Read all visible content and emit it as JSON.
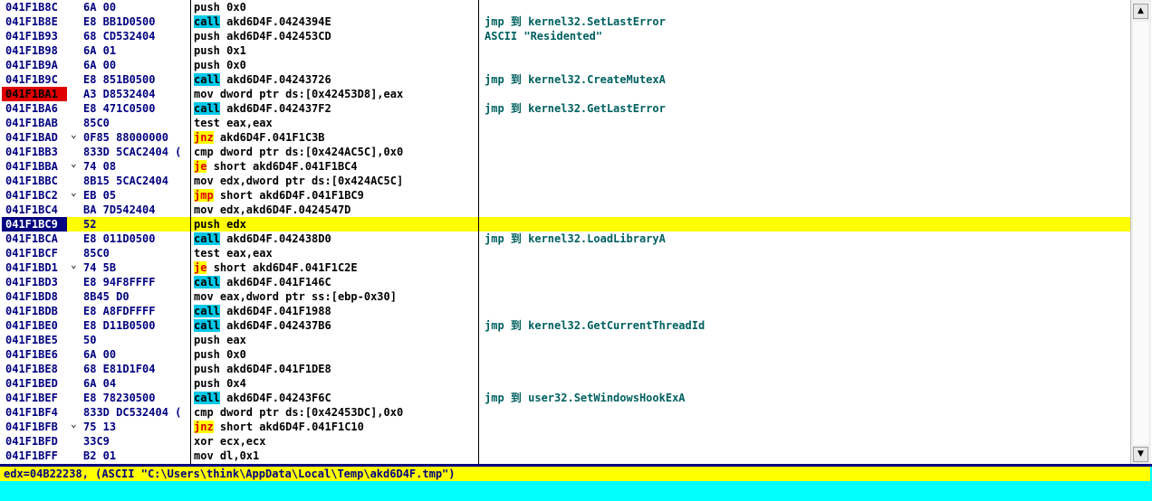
{
  "disasm": {
    "rows": [
      {
        "addr": "041F1B8C",
        "hex": "6A 00",
        "asm": "push 0x0",
        "cmt": ""
      },
      {
        "addr": "041F1B8E",
        "hex": "E8 BB1D0500",
        "kw": "call",
        "kwType": "call",
        "asm": "akd6D4F.0424394E",
        "cmt": "jmp 到 kernel32.SetLastError"
      },
      {
        "addr": "041F1B93",
        "hex": "68 CD532404",
        "asm": "push akd6D4F.042453CD",
        "cmt": "ASCII \"Residented\""
      },
      {
        "addr": "041F1B98",
        "hex": "6A 01",
        "asm": "push 0x1",
        "cmt": ""
      },
      {
        "addr": "041F1B9A",
        "hex": "6A 00",
        "asm": "push 0x0",
        "cmt": ""
      },
      {
        "addr": "041F1B9C",
        "hex": "E8 851B0500",
        "kw": "call",
        "kwType": "call",
        "asm": "akd6D4F.04243726",
        "cmt": "jmp 到 kernel32.CreateMutexA"
      },
      {
        "addr": "041F1BA1",
        "hex": "A3 D8532404",
        "asm": "mov dword ptr ds:[0x42453D8],eax",
        "cmt": "",
        "bp": true
      },
      {
        "addr": "041F1BA6",
        "hex": "E8 471C0500",
        "kw": "call",
        "kwType": "call",
        "asm": "akd6D4F.042437F2",
        "cmt": "jmp 到 kernel32.GetLastError"
      },
      {
        "addr": "041F1BAB",
        "hex": "85C0",
        "asm": "test eax,eax",
        "cmt": ""
      },
      {
        "addr": "041F1BAD",
        "hex": "0F85 88000000",
        "kw": "jnz",
        "kwType": "jmp",
        "asm": "akd6D4F.041F1C3B",
        "cmt": "",
        "mark": "⌄"
      },
      {
        "addr": "041F1BB3",
        "hex": "833D 5CAC2404 (",
        "asm": "cmp dword ptr ds:[0x424AC5C],0x0",
        "cmt": ""
      },
      {
        "addr": "041F1BBA",
        "hex": "74 08",
        "kw": "je",
        "kwType": "jmp",
        "asm": "short akd6D4F.041F1BC4",
        "cmt": "",
        "mark": "⌄"
      },
      {
        "addr": "041F1BBC",
        "hex": "8B15 5CAC2404",
        "asm": "mov edx,dword ptr ds:[0x424AC5C]",
        "cmt": ""
      },
      {
        "addr": "041F1BC2",
        "hex": "EB 05",
        "kw": "jmp",
        "kwType": "jmp",
        "asm": "short akd6D4F.041F1BC9",
        "cmt": "",
        "mark": "⌄"
      },
      {
        "addr": "041F1BC4",
        "hex": "BA 7D542404",
        "asm": "mov edx,akd6D4F.0424547D",
        "cmt": ""
      },
      {
        "addr": "041F1BC9",
        "hex": "52",
        "asm": "push edx",
        "cmt": "",
        "eip": true
      },
      {
        "addr": "041F1BCA",
        "hex": "E8 011D0500",
        "kw": "call",
        "kwType": "call",
        "asm": "akd6D4F.042438D0",
        "cmt": "jmp 到 kernel32.LoadLibraryA"
      },
      {
        "addr": "041F1BCF",
        "hex": "85C0",
        "asm": "test eax,eax",
        "cmt": ""
      },
      {
        "addr": "041F1BD1",
        "hex": "74 5B",
        "kw": "je",
        "kwType": "jmp",
        "asm": "short akd6D4F.041F1C2E",
        "cmt": "",
        "mark": "⌄"
      },
      {
        "addr": "041F1BD3",
        "hex": "E8 94F8FFFF",
        "kw": "call",
        "kwType": "call",
        "asm": "akd6D4F.041F146C",
        "cmt": ""
      },
      {
        "addr": "041F1BD8",
        "hex": "8B45 D0",
        "asm": "mov eax,dword ptr ss:[ebp-0x30]",
        "cmt": ""
      },
      {
        "addr": "041F1BDB",
        "hex": "E8 A8FDFFFF",
        "kw": "call",
        "kwType": "call",
        "asm": "akd6D4F.041F1988",
        "cmt": ""
      },
      {
        "addr": "041F1BE0",
        "hex": "E8 D11B0500",
        "kw": "call",
        "kwType": "call",
        "asm": "akd6D4F.042437B6",
        "cmt": "jmp 到 kernel32.GetCurrentThreadId"
      },
      {
        "addr": "041F1BE5",
        "hex": "50",
        "asm": "push eax",
        "cmt": ""
      },
      {
        "addr": "041F1BE6",
        "hex": "6A 00",
        "asm": "push 0x0",
        "cmt": ""
      },
      {
        "addr": "041F1BE8",
        "hex": "68 E81D1F04",
        "asm": "push akd6D4F.041F1DE8",
        "cmt": ""
      },
      {
        "addr": "041F1BED",
        "hex": "6A 04",
        "asm": "push 0x4",
        "cmt": ""
      },
      {
        "addr": "041F1BEF",
        "hex": "E8 78230500",
        "kw": "call",
        "kwType": "call",
        "asm": "akd6D4F.04243F6C",
        "cmt": "jmp 到 user32.SetWindowsHookExA"
      },
      {
        "addr": "041F1BF4",
        "hex": "833D DC532404 (",
        "asm": "cmp dword ptr ds:[0x42453DC],0x0",
        "cmt": ""
      },
      {
        "addr": "041F1BFB",
        "hex": "75 13",
        "kw": "jnz",
        "kwType": "jmp",
        "asm": "short akd6D4F.041F1C10",
        "cmt": "",
        "mark": "⌄"
      },
      {
        "addr": "041F1BFD",
        "hex": "33C9",
        "asm": "xor ecx,ecx",
        "cmt": ""
      },
      {
        "addr": "041F1BFF",
        "hex": "B2 01",
        "asm": "mov dl,0x1",
        "cmt": ""
      }
    ]
  },
  "scrollbar": {
    "up_glyph": "▲",
    "down_glyph": "▼"
  },
  "info": {
    "line": "edx=04B22238, (ASCII \"C:\\Users\\think\\AppData\\Local\\Temp\\akd6D4F.tmp\")"
  }
}
